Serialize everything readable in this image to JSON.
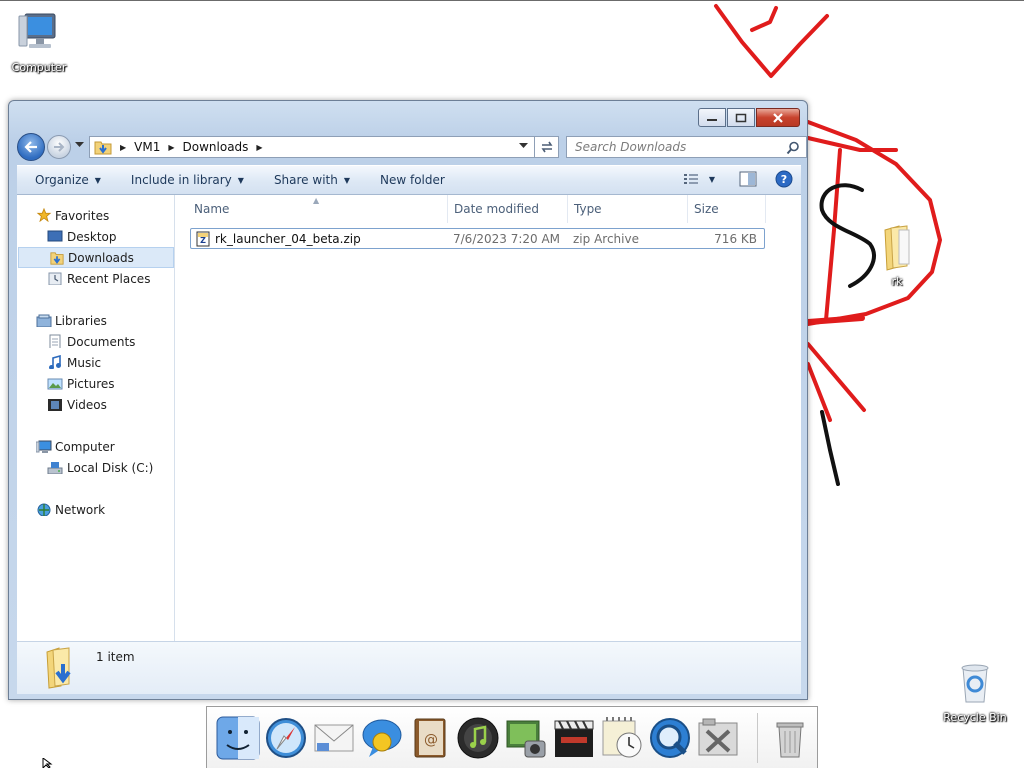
{
  "desktop": {
    "icons": [
      {
        "name": "computer",
        "label": "Computer"
      },
      {
        "name": "rk-folder",
        "label": "rk"
      },
      {
        "name": "recycle-bin",
        "label": "Recycle Bin"
      }
    ]
  },
  "window": {
    "address": {
      "segments": [
        "VM1",
        "Downloads"
      ]
    },
    "search": {
      "placeholder": "Search Downloads"
    },
    "toolbar": {
      "organize": "Organize",
      "include_in_library": "Include in library",
      "share_with": "Share with",
      "new_folder": "New folder"
    },
    "nav_pane": {
      "favorites": "Favorites",
      "desktop": "Desktop",
      "downloads": "Downloads",
      "recent_places": "Recent Places",
      "libraries": "Libraries",
      "documents": "Documents",
      "music": "Music",
      "pictures": "Pictures",
      "videos": "Videos",
      "computer": "Computer",
      "local_disk": "Local Disk (C:)",
      "network": "Network"
    },
    "columns": {
      "name": "Name",
      "date_modified": "Date modified",
      "type": "Type",
      "size": "Size"
    },
    "files": [
      {
        "name": "rk_launcher_04_beta.zip",
        "date_modified": "7/6/2023 7:20 AM",
        "type": "zip Archive",
        "size": "716 KB"
      }
    ],
    "details": {
      "item_count": "1 item"
    }
  },
  "dock": {
    "items": [
      "finder-icon",
      "safari-icon",
      "mail-icon",
      "ichat-icon",
      "address-book-icon",
      "itunes-icon",
      "iphoto-icon",
      "imovie-icon",
      "ical-icon",
      "quicktime-icon",
      "utilities-icon",
      "trash-icon"
    ]
  },
  "colors": {
    "scribble_red": "#e01c1c",
    "scribble_black": "#111111",
    "selection_fill": "#dbe9f8"
  }
}
